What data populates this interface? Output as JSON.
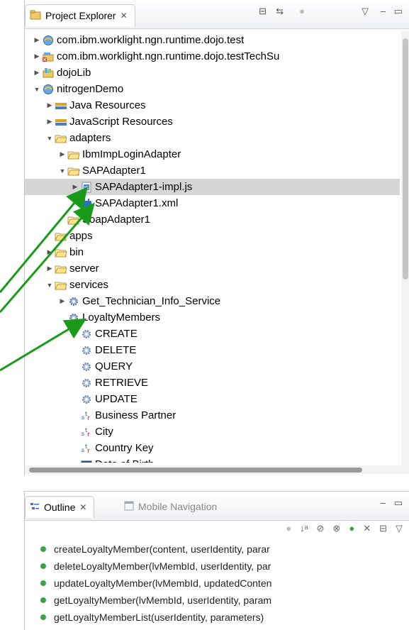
{
  "project_explorer": {
    "tab_title": "Project Explorer",
    "tree": [
      {
        "label": "com.ibm.worklight.ngn.runtime.dojo.test",
        "icon": "project-icon",
        "twisty": "▶",
        "level": 1
      },
      {
        "label": "com.ibm.worklight.ngn.runtime.dojo.testTechSu",
        "icon": "project-error-icon",
        "twisty": "▶",
        "level": 1
      },
      {
        "label": "dojoLib",
        "icon": "library-icon",
        "twisty": "▶",
        "level": 1
      },
      {
        "label": "nitrogenDemo",
        "icon": "project-icon",
        "twisty": "▼",
        "level": 1
      },
      {
        "label": "Java Resources",
        "icon": "java-resources-icon",
        "twisty": "▶",
        "level": 2
      },
      {
        "label": "JavaScript Resources",
        "icon": "javascript-resources-icon",
        "twisty": "▶",
        "level": 2
      },
      {
        "label": "adapters",
        "icon": "folder-icon",
        "twisty": "▼",
        "level": 2
      },
      {
        "label": "IbmImpLoginAdapter",
        "icon": "folder-icon",
        "twisty": "▶",
        "level": 3
      },
      {
        "label": "SAPAdapter1",
        "icon": "folder-icon",
        "twisty": "▼",
        "level": 3
      },
      {
        "label": "SAPAdapter1-impl.js",
        "icon": "js-file-icon",
        "twisty": "▶",
        "level": 4,
        "selected": true
      },
      {
        "label": "SAPAdapter1.xml",
        "icon": "adapter-xml-icon",
        "twisty": "",
        "level": 4
      },
      {
        "label": "SoapAdapter1",
        "icon": "folder-icon",
        "twisty": "",
        "level": 3
      },
      {
        "label": "apps",
        "icon": "folder-icon",
        "twisty": "",
        "level": 2
      },
      {
        "label": "bin",
        "icon": "folder-icon",
        "twisty": "▶",
        "level": 2
      },
      {
        "label": "server",
        "icon": "folder-icon",
        "twisty": "▶",
        "level": 2
      },
      {
        "label": "services",
        "icon": "folder-icon",
        "twisty": "▼",
        "level": 2
      },
      {
        "label": "Get_Technician_Info_Service",
        "icon": "service-gear-icon",
        "twisty": "▶",
        "level": 3
      },
      {
        "label": "LoyaltyMembers",
        "icon": "service-gear-icon",
        "twisty": "",
        "level": 3
      },
      {
        "label": "CREATE",
        "icon": "operation-gear-icon",
        "twisty": "",
        "level": 4
      },
      {
        "label": "DELETE",
        "icon": "operation-gear-icon",
        "twisty": "",
        "level": 4
      },
      {
        "label": "QUERY",
        "icon": "operation-gear-icon",
        "twisty": "",
        "level": 4
      },
      {
        "label": "RETRIEVE",
        "icon": "operation-gear-icon",
        "twisty": "",
        "level": 4
      },
      {
        "label": "UPDATE",
        "icon": "operation-gear-icon",
        "twisty": "",
        "level": 4
      },
      {
        "label": "Business Partner",
        "icon": "string-type-icon",
        "twisty": "",
        "level": 4
      },
      {
        "label": "City",
        "icon": "string-type-icon",
        "twisty": "",
        "level": 4
      },
      {
        "label": "Country Key",
        "icon": "string-type-icon",
        "twisty": "",
        "level": 4
      },
      {
        "label": "Date of Birth",
        "icon": "date-type-icon",
        "twisty": "",
        "level": 4
      }
    ]
  },
  "outline": {
    "tab_title": "Outline",
    "second_tab": "Mobile Navigation",
    "items": [
      "createLoyaltyMember(content, userIdentity, parar",
      "deleteLoyaltyMember(lvMembId, userIdentity, par",
      "updateLoyaltyMember(lvMembId, updatedConten",
      "getLoyaltyMember(lvMembId, userIdentity, param",
      "getLoyaltyMemberList(userIdentity, parameters)"
    ]
  },
  "colors": {
    "arrow": "#1a9a1a",
    "selection": "#d6d6d6",
    "method_dot": "#3aa347"
  }
}
